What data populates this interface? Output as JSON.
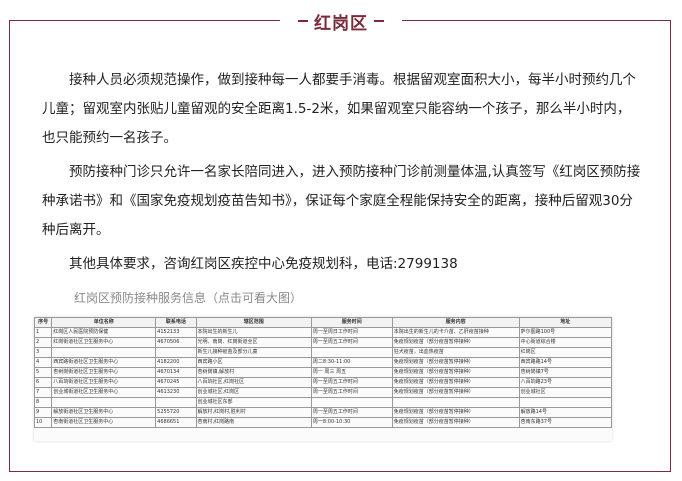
{
  "header": {
    "title": "红岗区"
  },
  "paragraphs": [
    "接种人员必须规范操作，做到接种每一人都要手消毒。根据留观室面积大小，每半小时预约几个儿童；留观室内张贴儿童留观的安全距离1.5-2米，如果留观室只能容纳一个孩子，那么半小时内，也只能预约一名孩子。",
    "预防接种门诊只允许一名家长陪同进入，进入预防接种门诊前测量体温,认真签写《红岗区预防接种承诺书》和《国家免疫规划疫苗告知书》，保证每个家庭全程能保持安全的距离，接种后留观30分种后离开。",
    "其他具体要求，咨询红岗区疾控中心免疫规划科，电话:2799138"
  ],
  "image_caption": "红岗区预防接种服务信息（点击可看大图）",
  "table": {
    "headers": [
      "序号",
      "单位名称",
      "联系电话",
      "辖区范围",
      "服务时间",
      "服务内容",
      "地址"
    ],
    "rows": [
      [
        "1",
        "红岗区人民医院预防保健",
        "4152133",
        "本院出生的新生儿",
        "周一至周日工作时间",
        "本院出生的新生儿的卡介苗、乙肝疫苗接种",
        "萨尔图路100号"
      ],
      [
        "2",
        "红岗街道社区卫生服务中心",
        "4670506",
        "光明、南岗、红岗街道全区",
        "周一至周五工作时间",
        "免疫规划疫苗（部分疫苗暂停接种）",
        "中心街道综合楼"
      ],
      [
        "3",
        "",
        "",
        "新生儿接种疫苗及部分儿童",
        "",
        "狂犬疫苗，出血热疫苗",
        "红岗区"
      ],
      [
        "4",
        "西宾路街道社区卫生服务中心",
        "4182200",
        "西宾路小区",
        "周二8:30-11:00",
        "免疫规划疫苗（部分疫苗暂停接种）",
        "西宾路路14号"
      ],
      [
        "5",
        "杏树岗街道社区卫生服务中心",
        "4670134",
        "杏树岗镇,解放村",
        "周一 周三 周五",
        "免疫规划疫苗（部分疫苗暂停接种）",
        "杏树岗镇7号"
      ],
      [
        "6",
        "八百垧街道社区卫生服务中心",
        "4670245",
        "八百垧社区,红岗社区",
        "周一至周五工作时间",
        "免疫规划疫苗（部分疫苗暂停接种）",
        "八百垧路23号"
      ],
      [
        "7",
        "创业城街道社区卫生服务中心",
        "4613230",
        "创业城社区,红岗区",
        "周一至周五工作时间",
        "免疫规划疫苗（部分疫苗暂停接种）",
        "创业城社区"
      ],
      [
        "8",
        "",
        "",
        "创业城社区东部",
        "",
        "",
        ""
      ],
      [
        "9",
        "解放街道社区卫生服务中心",
        "5255720",
        "解放村,红岗村,胜利村",
        "周一至周五工作时间",
        "免疫规划疫苗（部分疫苗暂停接种）",
        "解放路14号"
      ],
      [
        "10",
        "杏南街道社区卫生服务中心",
        "4686651",
        "杏南村,红岗路南",
        "周一8:00-10:30",
        "免疫规划疫苗（部分疫苗暂停接种）",
        "杏南东路37号"
      ]
    ]
  }
}
